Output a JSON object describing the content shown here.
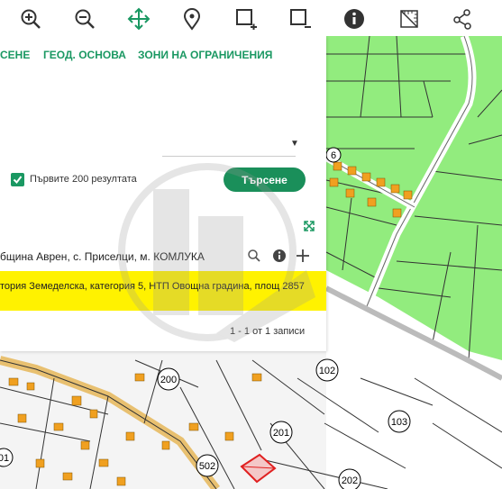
{
  "toolbar": {
    "tools": [
      {
        "name": "zoom-in-icon"
      },
      {
        "name": "zoom-out-icon"
      },
      {
        "name": "pan-move-icon"
      },
      {
        "name": "location-pin-icon"
      },
      {
        "name": "select-area-add-icon"
      },
      {
        "name": "select-area-remove-icon"
      },
      {
        "name": "info-icon"
      },
      {
        "name": "measure-ruler-icon"
      },
      {
        "name": "share-nodes-icon"
      }
    ]
  },
  "panel": {
    "tabs": [
      "СЕНЕ",
      "ГЕОД. ОСНОВА",
      "ЗОНИ НА ОГРАНИЧЕНИЯ"
    ],
    "checkbox_label": "Първите 200 резултата",
    "search_button": "Търсене",
    "result_title": "бщина Аврен, с. Приселци, м. КОМЛУКА",
    "result_row": "тория Земеделска, категория 5, НТП Овощна градина, площ 2857",
    "pager": "1 - 1 от 1 записи"
  },
  "map": {
    "parcel_labels": [
      "200",
      "102",
      "201",
      "103",
      "502",
      "202",
      "6",
      "01"
    ]
  },
  "colors": {
    "accent": "#1a9862",
    "highlight": "#fff200",
    "map_green": "#90ee7c",
    "building": "#f0a020"
  }
}
